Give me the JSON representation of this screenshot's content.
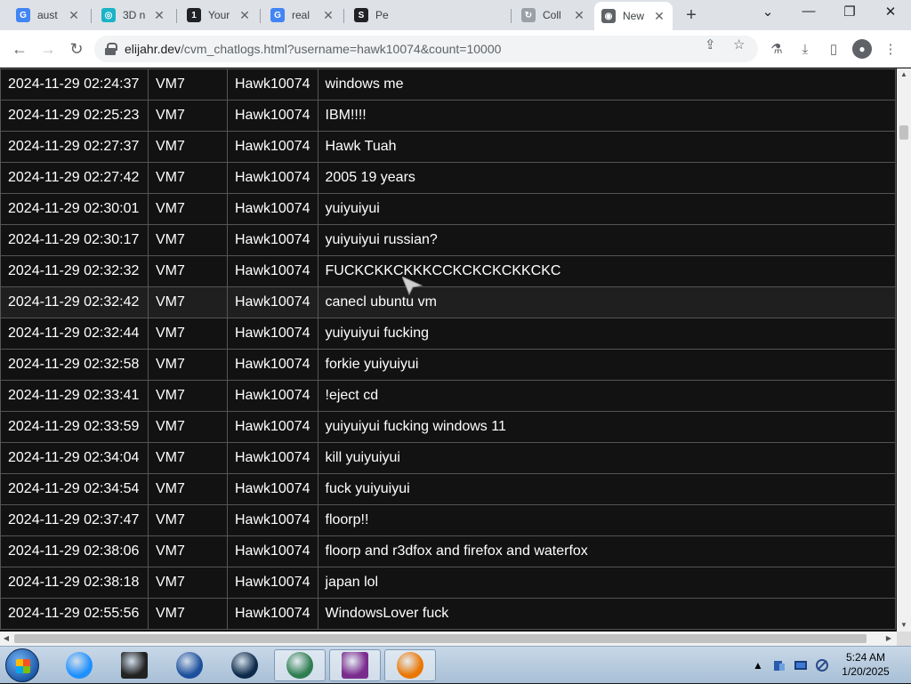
{
  "browser": {
    "tabs": [
      {
        "title": "aust",
        "favicon": "google-icon",
        "color": "#4285f4",
        "glyph": "G"
      },
      {
        "title": "3D n",
        "favicon": "vortex-icon",
        "color": "#1ab3c7",
        "glyph": "◎"
      },
      {
        "title": "Your",
        "favicon": "onepass-icon",
        "color": "#202124",
        "glyph": "1"
      },
      {
        "title": "real",
        "favicon": "google-icon",
        "color": "#4285f4",
        "glyph": "G"
      },
      {
        "title": "Pe",
        "favicon": "scribd-icon",
        "color": "#202124",
        "glyph": "S"
      },
      {
        "title": "Coll",
        "favicon": "loading-icon",
        "color": "#9aa0a6",
        "glyph": "↻"
      },
      {
        "title": "New",
        "favicon": "chrome-icon",
        "color": "#5f6368",
        "glyph": "◉"
      }
    ],
    "new_tab_label": "+",
    "url_host": "elijahr.dev",
    "url_path": "/cvm_chatlogs.html?username=hawk10074&count=10000"
  },
  "chatlog": {
    "rows": [
      {
        "time": "2024-11-29 02:24:37",
        "vm": "VM7",
        "user": "Hawk10074",
        "message": "windows me"
      },
      {
        "time": "2024-11-29 02:25:23",
        "vm": "VM7",
        "user": "Hawk10074",
        "message": "IBM!!!!"
      },
      {
        "time": "2024-11-29 02:27:37",
        "vm": "VM7",
        "user": "Hawk10074",
        "message": "Hawk Tuah"
      },
      {
        "time": "2024-11-29 02:27:42",
        "vm": "VM7",
        "user": "Hawk10074",
        "message": "2005 19 years"
      },
      {
        "time": "2024-11-29 02:30:01",
        "vm": "VM7",
        "user": "Hawk10074",
        "message": "yuiyuiyui"
      },
      {
        "time": "2024-11-29 02:30:17",
        "vm": "VM7",
        "user": "Hawk10074",
        "message": "yuiyuiyui russian?"
      },
      {
        "time": "2024-11-29 02:32:32",
        "vm": "VM7",
        "user": "Hawk10074",
        "message": "FUCKCKKCKKKCCKCKCKCKKCKC"
      },
      {
        "time": "2024-11-29 02:32:42",
        "vm": "VM7",
        "user": "Hawk10074",
        "message": "canecl ubuntu vm"
      },
      {
        "time": "2024-11-29 02:32:44",
        "vm": "VM7",
        "user": "Hawk10074",
        "message": "yuiyuiyui fucking"
      },
      {
        "time": "2024-11-29 02:32:58",
        "vm": "VM7",
        "user": "Hawk10074",
        "message": "forkie yuiyuiyui"
      },
      {
        "time": "2024-11-29 02:33:41",
        "vm": "VM7",
        "user": "Hawk10074",
        "message": "!eject cd"
      },
      {
        "time": "2024-11-29 02:33:59",
        "vm": "VM7",
        "user": "Hawk10074",
        "message": "yuiyuiyui fucking windows 11"
      },
      {
        "time": "2024-11-29 02:34:04",
        "vm": "VM7",
        "user": "Hawk10074",
        "message": "kill yuiyuiyui"
      },
      {
        "time": "2024-11-29 02:34:54",
        "vm": "VM7",
        "user": "Hawk10074",
        "message": "fuck yuiyuiyui"
      },
      {
        "time": "2024-11-29 02:37:47",
        "vm": "VM7",
        "user": "Hawk10074",
        "message": "floorp!!"
      },
      {
        "time": "2024-11-29 02:38:06",
        "vm": "VM7",
        "user": "Hawk10074",
        "message": "floorp and r3dfox and firefox and waterfox"
      },
      {
        "time": "2024-11-29 02:38:18",
        "vm": "VM7",
        "user": "Hawk10074",
        "message": "japan lol"
      },
      {
        "time": "2024-11-29 02:55:56",
        "vm": "VM7",
        "user": "Hawk10074",
        "message": "WindowsLover fuck"
      }
    ],
    "hovered_row": 7
  },
  "taskbar": {
    "apps": [
      {
        "name": "ie-icon",
        "running": false,
        "color": "#1e90ff"
      },
      {
        "name": "terminal-icon",
        "running": false,
        "color": "#222222"
      },
      {
        "name": "media-player-icon",
        "running": false,
        "color": "#1c4f9c"
      },
      {
        "name": "globe-icon",
        "running": false,
        "color": "#0d2a4a"
      },
      {
        "name": "browser-icon",
        "running": true,
        "color": "#2e7d4f"
      },
      {
        "name": "winrar-icon",
        "running": true,
        "color": "#7b2d8e"
      },
      {
        "name": "blender-icon",
        "running": true,
        "color": "#ea7600"
      }
    ],
    "clock_time": "5:24 AM",
    "clock_date": "1/20/2025"
  }
}
